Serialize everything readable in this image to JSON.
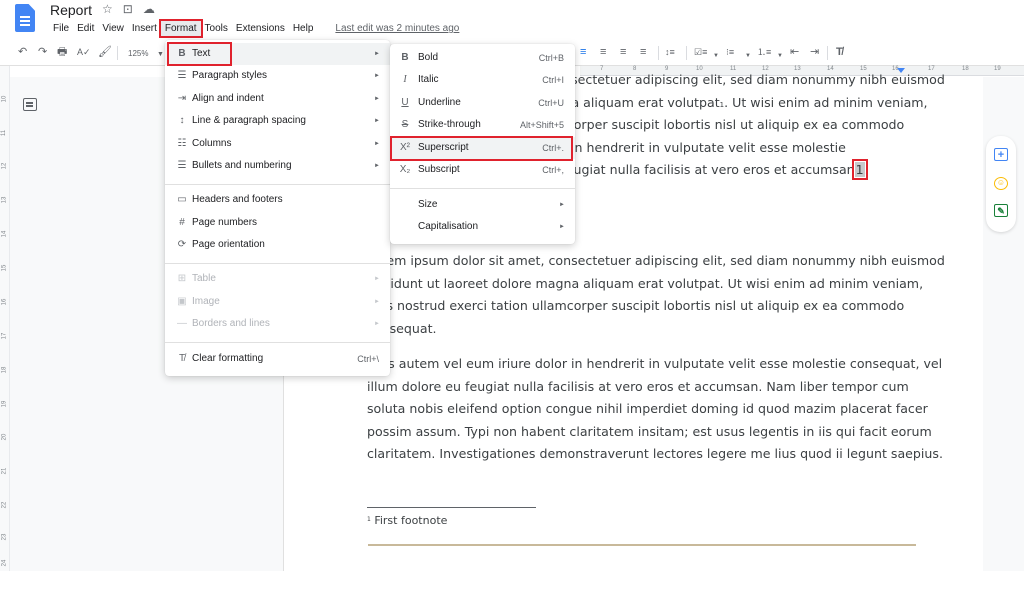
{
  "app": {
    "title": "Report",
    "menu": [
      "File",
      "Edit",
      "View",
      "Insert",
      "Format",
      "Tools",
      "Extensions",
      "Help"
    ],
    "active_menu": "Format",
    "last_edit": "Last edit was 2 minutes ago"
  },
  "toolbar": {
    "zoom": "125%",
    "undo_icon": "↶",
    "redo_icon": "↷",
    "print_icon": "🖶",
    "spellcheck_icon": "A✓",
    "paint_format_icon": "🖌",
    "align_left_icon": "≡",
    "align_center_icon": "≡",
    "align_right_icon": "≡",
    "justify_icon": "≡",
    "line_spacing_icon": "↕≡",
    "checklist_icon": "☑≡",
    "bullets_icon": "⁝≡",
    "numbered_icon": "⒈≡",
    "decrease_indent_icon": "⇤",
    "increase_indent_icon": "⇥",
    "clear_format_icon": "T̸"
  },
  "ruler": {
    "h_ticks": [
      "7",
      "8",
      "9",
      "10",
      "11",
      "12",
      "13",
      "14",
      "15",
      "16",
      "17",
      "18",
      "19"
    ],
    "v_ticks": [
      "10",
      "11",
      "12",
      "13",
      "14",
      "15",
      "16",
      "17",
      "18",
      "19",
      "20",
      "21",
      "22",
      "23",
      "24"
    ]
  },
  "format_menu": {
    "items": [
      {
        "icon": "B",
        "label": "Text",
        "submenu": true
      },
      {
        "icon": "☰",
        "label": "Paragraph styles",
        "submenu": true
      },
      {
        "icon": "⇥",
        "label": "Align and indent",
        "submenu": true
      },
      {
        "icon": "↕",
        "label": "Line & paragraph spacing",
        "submenu": true
      },
      {
        "icon": "☷",
        "label": "Columns",
        "submenu": true
      },
      {
        "icon": "☰",
        "label": "Bullets and numbering",
        "submenu": true
      },
      {
        "icon": "▭",
        "label": "Headers and footers"
      },
      {
        "icon": "#",
        "label": "Page numbers"
      },
      {
        "icon": "⟳",
        "label": "Page orientation"
      },
      {
        "icon": "⊞",
        "label": "Table",
        "submenu": true,
        "disabled": true
      },
      {
        "icon": "▣",
        "label": "Image",
        "submenu": true,
        "disabled": true
      },
      {
        "icon": "—",
        "label": "Borders and lines",
        "submenu": true,
        "disabled": true
      },
      {
        "icon": "T̸",
        "label": "Clear formatting",
        "shortcut": "Ctrl+\\"
      }
    ],
    "arrow": "►"
  },
  "text_menu": {
    "items": [
      {
        "icon": "B",
        "label": "Bold",
        "shortcut": "Ctrl+B"
      },
      {
        "icon": "I",
        "label": "Italic",
        "shortcut": "Ctrl+I"
      },
      {
        "icon": "U",
        "label": "Underline",
        "shortcut": "Ctrl+U"
      },
      {
        "icon": "S",
        "label": "Strike-through",
        "shortcut": "Alt+Shift+5"
      },
      {
        "icon": "X²",
        "label": "Superscript",
        "shortcut": "Ctrl+."
      },
      {
        "icon": "X₂",
        "label": "Subscript",
        "shortcut": "Ctrl+,"
      },
      {
        "icon": "",
        "label": "Size",
        "submenu": true
      },
      {
        "icon": "",
        "label": "Capitalisation",
        "submenu": true
      }
    ],
    "highlighted": "Superscript"
  },
  "document": {
    "para1": [
      "Lorem ipsum dolor sit amet, consectetuer adipiscing elit, sed diam nonummy nibh euismod",
      "tincidunt ut laoreet dolore magna aliquam erat volutpat",
      ". Ut wisi enim ad minim veniam,",
      "quis nostrud exerci tation ullamcorper suscipit lobortis nisl ut aliquip ex ea commodo",
      "Duis autem vel eum iriure dolor in hendrerit in vulputate velit esse molestie",
      "consequat, vel illum dolore eu feugiat nulla facilisis at vero eros et accumsan",
      "1",
      "."
    ],
    "sup_mark": "1",
    "para2": [
      "Lorem ipsum dolor sit amet, consectetuer adipiscing elit, sed diam nonummy nibh euismod",
      "tincidunt ut laoreet dolore magna aliquam erat volutpat. Ut wisi enim ad minim veniam,",
      "quis nostrud exerci tation ullamcorper suscipit lobortis nisl ut aliquip ex ea commodo",
      "consequat."
    ],
    "para3": [
      "Duis autem vel eum iriure dolor in hendrerit in vulputate velit esse molestie consequat, vel",
      "illum dolore eu feugiat nulla facilisis at vero eros et accumsan. Nam liber tempor cum",
      "soluta nobis eleifend option congue nihil imperdiet doming id quod mazim placerat facer",
      "possim assum. Typi non habent claritatem insitam; est usus legentis in iis qui facit eorum",
      "claritatem. Investigationes demonstraverunt lectores legere me lius quod ii legunt saepius."
    ],
    "footnote_mark": "1",
    "footnote": "First footnote"
  },
  "side_panel": {
    "add_comment_icon": "+",
    "emoji_icon": "☺",
    "suggest_icon": "✎"
  }
}
